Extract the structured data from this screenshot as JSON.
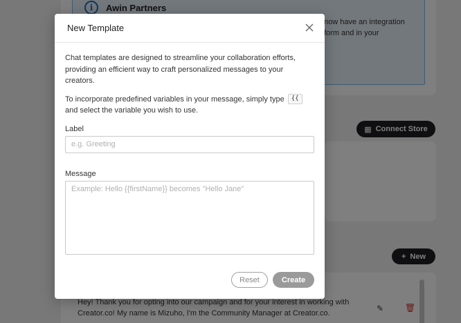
{
  "background": {
    "info_box": {
      "title": "Awin Partners",
      "text": "now have an integration form and in your"
    },
    "connect_store_label": "Connect Store",
    "new_label": "New",
    "message_preview": "Hey! Thank you for opting into our campaign and for your interest in working with Creator.co! My name is Mizuho, I'm the Community Manager at Creator.co."
  },
  "modal": {
    "title": "New Template",
    "description": "Chat templates are designed to streamline your collaboration efforts, providing an efficient way to craft personalized messages to your creators.",
    "variables_hint_before": "To incorporate predefined variables in your message, simply type",
    "variables_trigger": "{{",
    "variables_hint_after": "and select the variable you wish to use.",
    "label_field": {
      "label": "Label",
      "placeholder": "e.g. Greeting",
      "value": ""
    },
    "message_field": {
      "label": "Message",
      "placeholder": "Example: Hello {{firstName}} becomes \"Hello Jane\"",
      "value": ""
    },
    "reset_label": "Reset",
    "create_label": "Create"
  },
  "colors": {
    "primary_dark": "#1e1f24",
    "disabled_button": "#9a9a9a",
    "info_border": "#79b6e4",
    "delete_red": "#d32f2f"
  }
}
